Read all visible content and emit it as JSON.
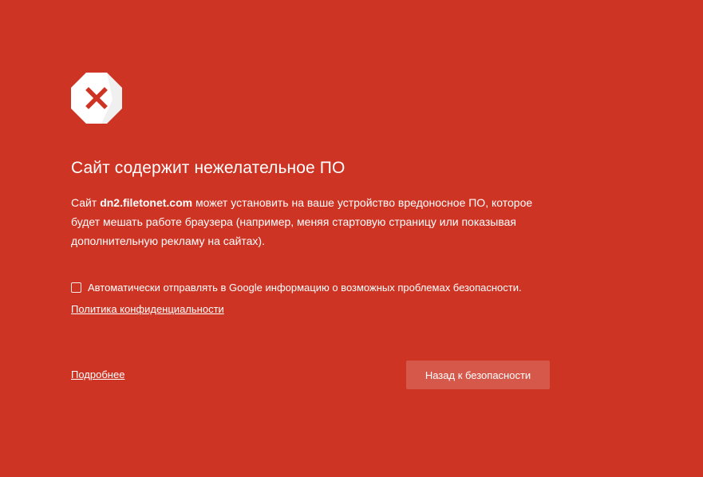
{
  "warning": {
    "icon": "warning-x-icon",
    "colors": {
      "background": "#cd3424",
      "icon_fill": "#ffffff",
      "icon_x": "#cd3424"
    }
  },
  "heading": "Сайт содержит нежелательное ПО",
  "description": {
    "prefix": "Сайт ",
    "domain": "dn2.filetonet.com",
    "suffix": " может установить на ваше устройство вредоносное ПО, которое будет мешать работе браузера (например, меняя стартовую страницу или показывая дополнительную рекламу на сайтах)."
  },
  "report": {
    "checkbox_label": "Автоматически отправлять в Google информацию о возможных проблемах безопасности.",
    "checked": false,
    "privacy_link": "Политика конфиденциальности"
  },
  "actions": {
    "details_link": "Подробнее",
    "back_button": "Назад к безопасности"
  }
}
